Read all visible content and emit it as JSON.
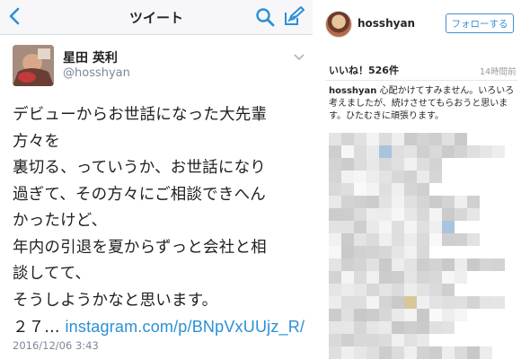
{
  "twitter": {
    "nav_title": "ツイート",
    "back_icon": "chevron-left-icon",
    "search_icon": "search-icon",
    "compose_icon": "compose-icon",
    "accent": "#2b8fd6",
    "display_name": "星田 英利",
    "handle": "@hosshyan",
    "tweet_lines": [
      "デビューからお世話になった大先輩",
      "方々を",
      "裏切る、っていうか、お世話になり",
      "過ぎて、その方々にご相談できへん",
      "かったけど、",
      "年内の引退を夏からずっと会社と相",
      "談してて、",
      "そうしようかなと思います。"
    ],
    "tweet_last_prefix": "２７...",
    "tweet_link": "instagram.com/p/BNpVxUUjz_R/",
    "timestamp": "2016/12/06 3:43"
  },
  "instagram": {
    "username": "hosshyan",
    "follow_label": "フォローする",
    "likes": "いいね！526件",
    "time_ago": "14時間前",
    "caption_user": "hosshyan",
    "caption_text": " 心配かけてすみません。いろいろ考えましたが、続けさせてもらおうと思います。ひたむきに頑張ります。"
  }
}
